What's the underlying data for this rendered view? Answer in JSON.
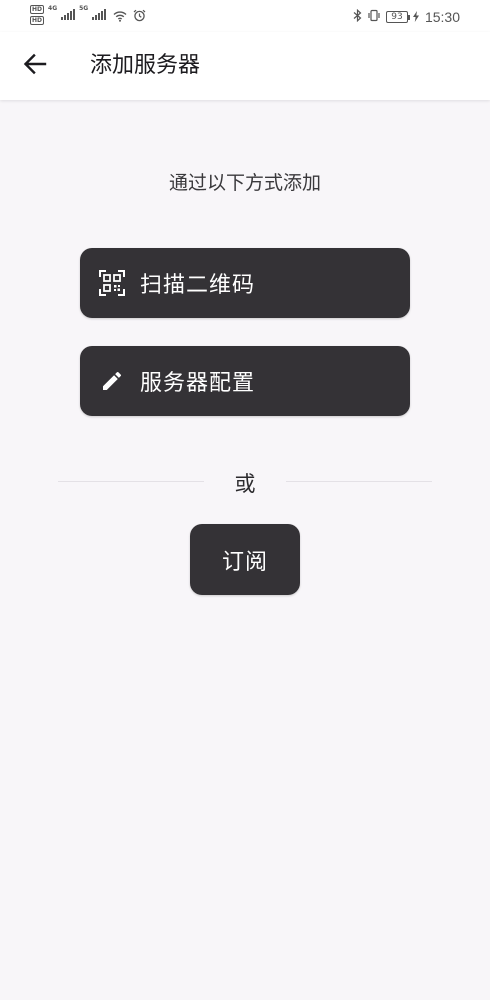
{
  "status_bar": {
    "hd_badge_1": "HD",
    "hd_badge_2": "HD",
    "network_1": "4G",
    "network_2": "5G",
    "battery_level": "93",
    "time": "15:30"
  },
  "app_bar": {
    "title": "添加服务器"
  },
  "main": {
    "subtitle": "通过以下方式添加",
    "scan_label": "扫描二维码",
    "config_label": "服务器配置",
    "or_label": "或",
    "subscribe_label": "订阅"
  },
  "icons": {
    "back": "arrow-left-icon",
    "scan": "qr-scan-icon",
    "config": "pencil-icon",
    "wifi": "wifi-icon",
    "alarm": "alarm-icon",
    "bluetooth": "bluetooth-icon",
    "vibrate": "vibrate-icon",
    "charging": "charging-bolt-icon"
  },
  "colors": {
    "background": "#f8f6f9",
    "button_bg": "#343236",
    "button_text": "#ffffff",
    "title_text": "#1c1b1f"
  }
}
